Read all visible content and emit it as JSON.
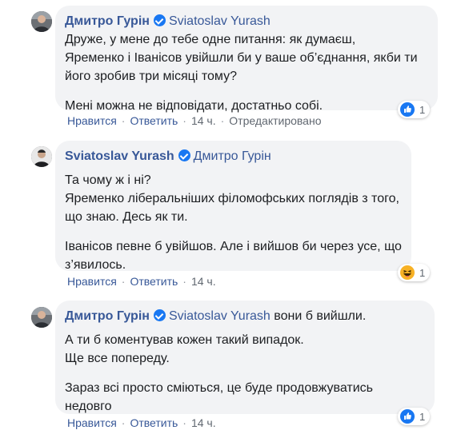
{
  "comments": [
    {
      "author": "Дмитро Гурін",
      "mention": "Sviatoslav Yurash",
      "mention_suffix": "",
      "paragraphs": [
        [
          "Друже, у мене до тебе одне питання: як думаєш,",
          "Яременко і Іванісов увійшли би у ваше об’єднання, якби ти",
          "його зробив три місяці тому?"
        ],
        [
          "Мені можна не відповідати, достатньо собі."
        ]
      ],
      "actions": {
        "like": "Нравится",
        "reply": "Ответить",
        "time": "14 ч.",
        "edited": "Отредактировано"
      },
      "reaction": {
        "icon": "like-icon",
        "count": "1"
      }
    },
    {
      "author": "Sviatoslav Yurash",
      "mention": "Дмитро Гурін",
      "mention_suffix": "",
      "paragraphs": [
        [
          "Та чому ж і ні?",
          "Яременко ліберальніших філомофських поглядів з того,",
          "що знаю. Десь як ти."
        ],
        [
          "Іванісов певне б увійшов. Але і вийшов би через усе, що",
          "з’явилось."
        ]
      ],
      "actions": {
        "like": "Нравится",
        "reply": "Ответить",
        "time": "14 ч."
      },
      "reaction": {
        "icon": "haha-icon",
        "count": "1"
      }
    },
    {
      "author": "Дмитро Гурін",
      "mention": "Sviatoslav Yurash",
      "mention_suffix": "вони б вийшли.",
      "paragraphs": [
        [
          "А ти б коментував кожен такий випадок.",
          "Ще все попереду."
        ],
        [
          "Зараз всі просто сміються, це буде продовжуватись",
          "недовго"
        ]
      ],
      "actions": {
        "like": "Нравится",
        "reply": "Ответить",
        "time": "14 ч."
      },
      "reaction": {
        "icon": "like-icon",
        "count": "1"
      }
    }
  ]
}
